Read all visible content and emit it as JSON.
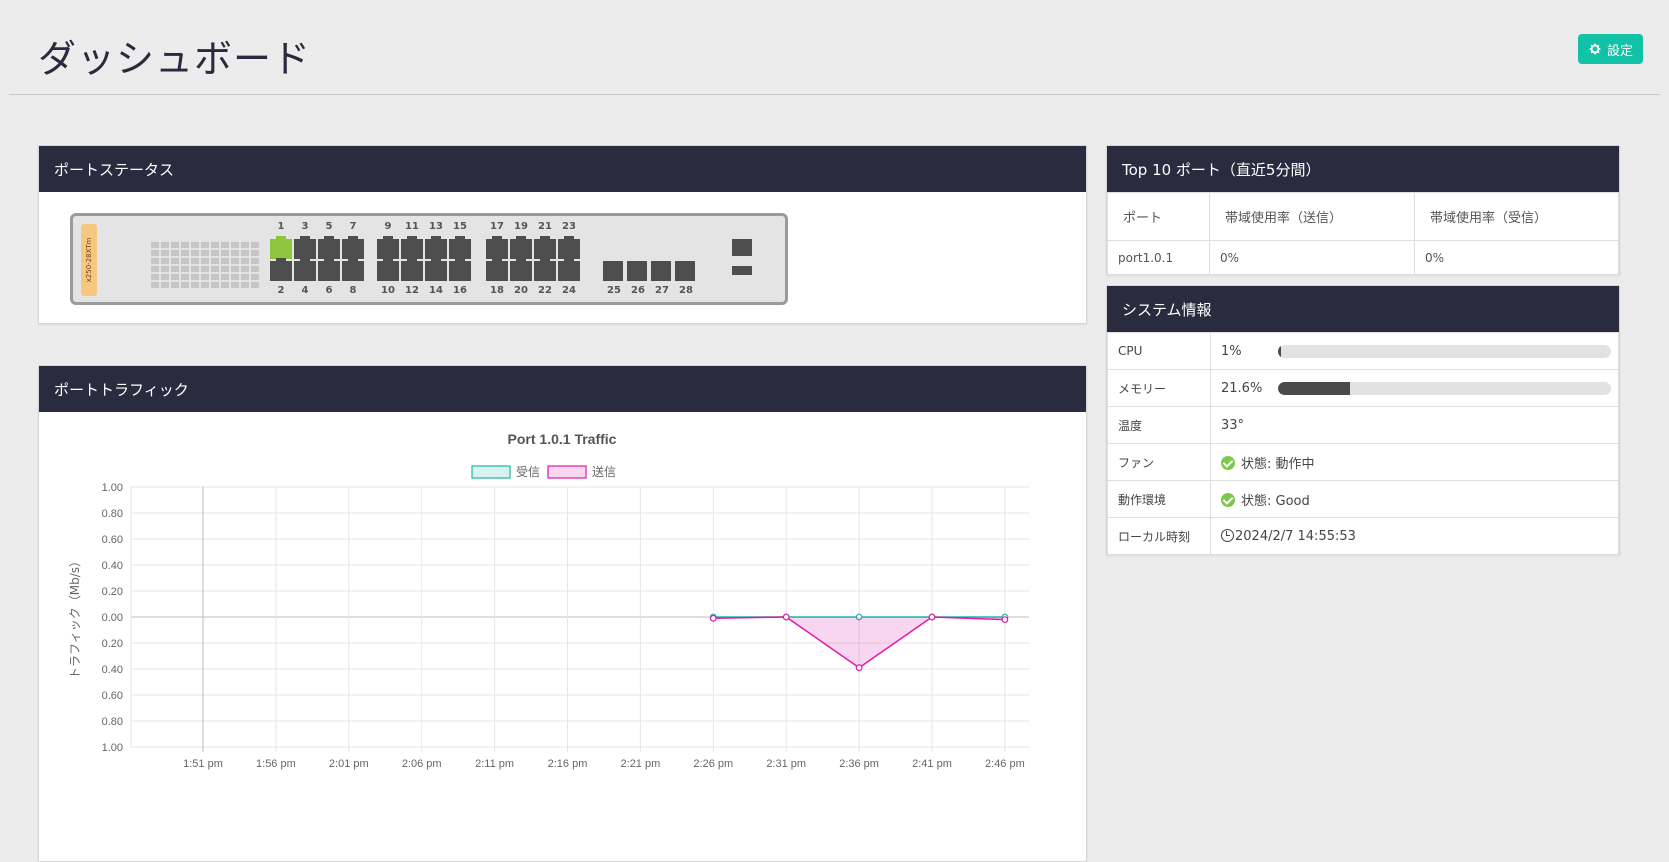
{
  "header": {
    "title": "ダッシュボード",
    "settings_label": "設定"
  },
  "port_status": {
    "title": "ポートステータス",
    "model": "x250-28XTm",
    "top_row": [
      "1",
      "3",
      "5",
      "7",
      "9",
      "11",
      "13",
      "15",
      "17",
      "19",
      "21",
      "23"
    ],
    "bottom_row": [
      "2",
      "4",
      "6",
      "8",
      "10",
      "12",
      "14",
      "16",
      "18",
      "20",
      "22",
      "24"
    ],
    "sfp": [
      "25",
      "26",
      "27",
      "28"
    ],
    "active_ports": [
      "1"
    ]
  },
  "top10": {
    "title": "Top 10 ポート（直近5分間）",
    "headers": [
      "ポート",
      "帯域使用率（送信）",
      "帯域使用率（受信）"
    ],
    "rows": [
      [
        "port1.0.1",
        "0%",
        "0%"
      ]
    ]
  },
  "system": {
    "title": "システム情報",
    "cpu_label": "CPU",
    "cpu_value": "1%",
    "cpu_fraction": 0.01,
    "mem_label": "メモリー",
    "mem_value": "21.6%",
    "mem_fraction": 0.216,
    "temp_label": "温度",
    "temp_value": "33°",
    "fan_label": "ファン",
    "fan_value": "状態: 動作中",
    "env_label": "動作環境",
    "env_value": "状態: Good",
    "time_label": "ローカル時刻",
    "time_value": "2024/2/7 14:55:53"
  },
  "traffic": {
    "title": "ポートトラフィック"
  },
  "chart_data": {
    "type": "line",
    "title": "Port 1.0.1 Traffic",
    "ylabel": "トラフィック（Mb/s）",
    "x": [
      "1:51 pm",
      "1:56 pm",
      "2:01 pm",
      "2:06 pm",
      "2:11 pm",
      "2:16 pm",
      "2:21 pm",
      "2:26 pm",
      "2:31 pm",
      "2:36 pm",
      "2:41 pm",
      "2:46 pm"
    ],
    "yticks": [
      "1.00",
      "0.80",
      "0.60",
      "0.40",
      "0.20",
      "0.00",
      "0.20",
      "0.40",
      "0.60",
      "0.80",
      "1.00"
    ],
    "ylim": [
      -1.0,
      1.0
    ],
    "series": [
      {
        "name": "受信",
        "color": "#1fb5a8",
        "values": [
          null,
          null,
          null,
          null,
          null,
          null,
          null,
          0.0,
          0.0,
          0.0,
          0.0,
          0.0
        ]
      },
      {
        "name": "送信",
        "color": "#e01aa8",
        "values": [
          null,
          null,
          null,
          null,
          null,
          null,
          null,
          -0.01,
          0.0,
          -0.39,
          0.0,
          -0.02
        ]
      }
    ],
    "grid": true,
    "legend": "top"
  }
}
